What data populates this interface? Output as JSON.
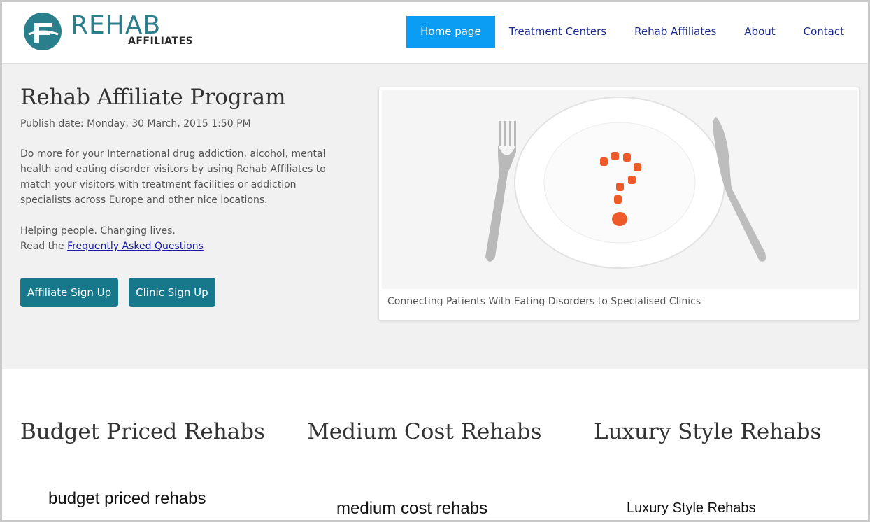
{
  "logo": {
    "word": "REHAB",
    "sub": "AFFILIATES",
    "color": "#2a7f8c"
  },
  "nav": {
    "items": [
      {
        "label": "Home page",
        "active": true
      },
      {
        "label": "Treatment Centers",
        "active": false
      },
      {
        "label": "Rehab Affiliates",
        "active": false
      },
      {
        "label": "About",
        "active": false
      },
      {
        "label": "Contact",
        "active": false
      }
    ],
    "active_color": "#0b9cf4"
  },
  "hero": {
    "title": "Rehab Affiliate Program",
    "publish_date": "Publish date: Monday, 30 March, 2015 1:50 PM",
    "description": "Do more for your International drug addiction, alcohol, mental health and eating disorder visitors by using Rehab Affiliates to match your visitors with treatment facilities or addiction specialists across Europe and other nice locations.",
    "tagline": "Helping people. Changing lives.",
    "faq_prefix": "Read the ",
    "faq_link": "Frequently Asked Questions",
    "buttons": {
      "affiliate": "Affiliate Sign Up",
      "clinic": "Clinic Sign Up"
    },
    "button_color": "#16788a",
    "image_caption": "Connecting Patients With Eating Disorders to Specialised Clinics"
  },
  "categories": [
    {
      "title": "Budget Priced Rehabs",
      "image_label": "budget priced rehabs"
    },
    {
      "title": "Medium Cost Rehabs",
      "image_label": "medium cost rehabs"
    },
    {
      "title": "Luxury Style Rehabs",
      "image_label": "Luxury Style Rehabs"
    }
  ]
}
